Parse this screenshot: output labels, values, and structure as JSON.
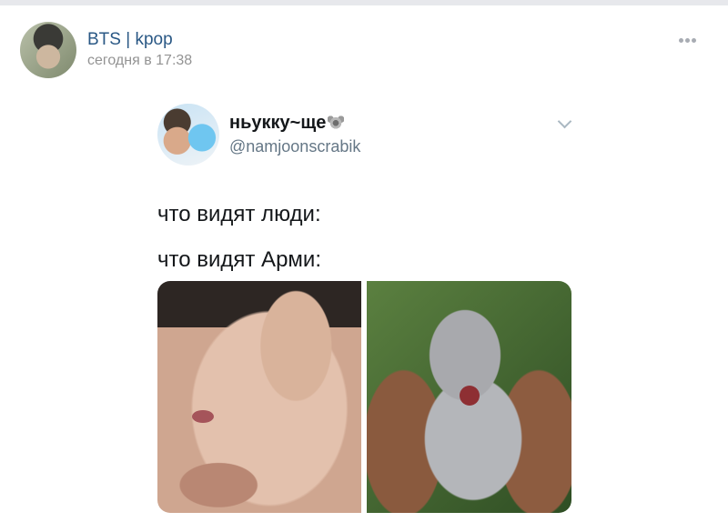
{
  "post": {
    "group_name": "BTS | kpop",
    "timestamp": "сегодня в 17:38",
    "avatar_icon": "group-avatar",
    "more_icon": "more-dots-icon"
  },
  "tweet": {
    "display_name": "ньукку~ще",
    "display_name_emoji": "koala-emoji",
    "handle": "@namjoonscrabik",
    "line1": "что видят люди:",
    "line2": "что видят Арми:",
    "images": [
      {
        "name": "sleeping-person-photo"
      },
      {
        "name": "yawning-bunny-photo"
      }
    ]
  },
  "colors": {
    "link": "#2a5885",
    "muted": "#939393",
    "twitter_muted": "#657786"
  }
}
